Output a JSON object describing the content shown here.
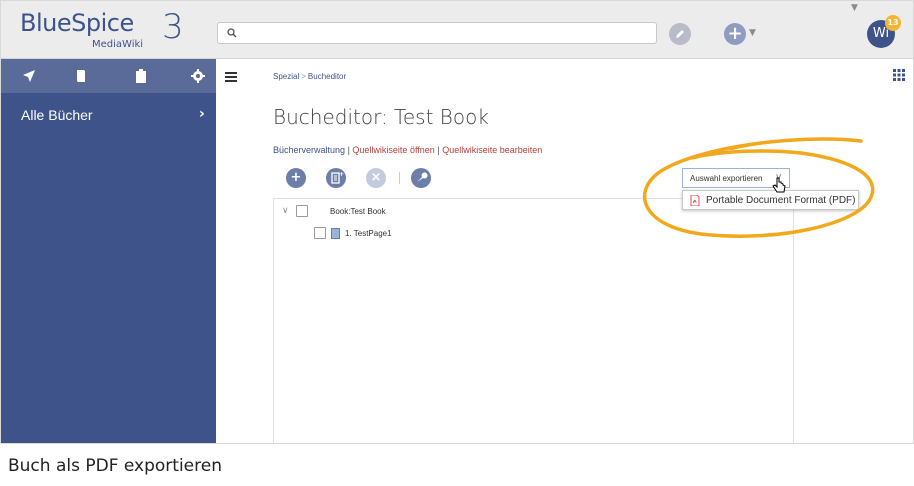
{
  "header": {
    "logo_word": "BlueSpice",
    "logo_sub": "MediaWiki",
    "logo_version": "3",
    "avatar_initials": "Wi",
    "notification_count": "13"
  },
  "sidebar": {
    "tabs": [
      "navigation-icon",
      "book-icon",
      "clipboard-icon",
      "gear-icon"
    ],
    "item_label": "Alle Bücher",
    "item_arrow": "›"
  },
  "main": {
    "breadcrumb": {
      "parent": "Spezial",
      "separator": ">",
      "current": "Bucheditor"
    },
    "title": "Bucheditor: Test Book",
    "links": {
      "manage": "Bücherverwaltung",
      "separator": "|",
      "open_source": "Quellwikiseite öffnen",
      "edit_source": "Quellwikiseite bearbeiten"
    },
    "toolbar": {
      "add_symbol": "+",
      "remove_symbol": "×"
    },
    "tree": {
      "root": "Book:Test Book",
      "children": [
        "1. TestPage1"
      ]
    },
    "export": {
      "dropdown_label": "Auswahl exportieren",
      "options": [
        "Portable Document Format (PDF)"
      ]
    }
  },
  "caption": "Buch als PDF exportieren",
  "colors": {
    "brand": "#3e5389",
    "sidebar_tabs": "#5b6b99",
    "link_red": "#b0403a",
    "highlight": "#f2a81d",
    "badge": "#f6b531"
  }
}
